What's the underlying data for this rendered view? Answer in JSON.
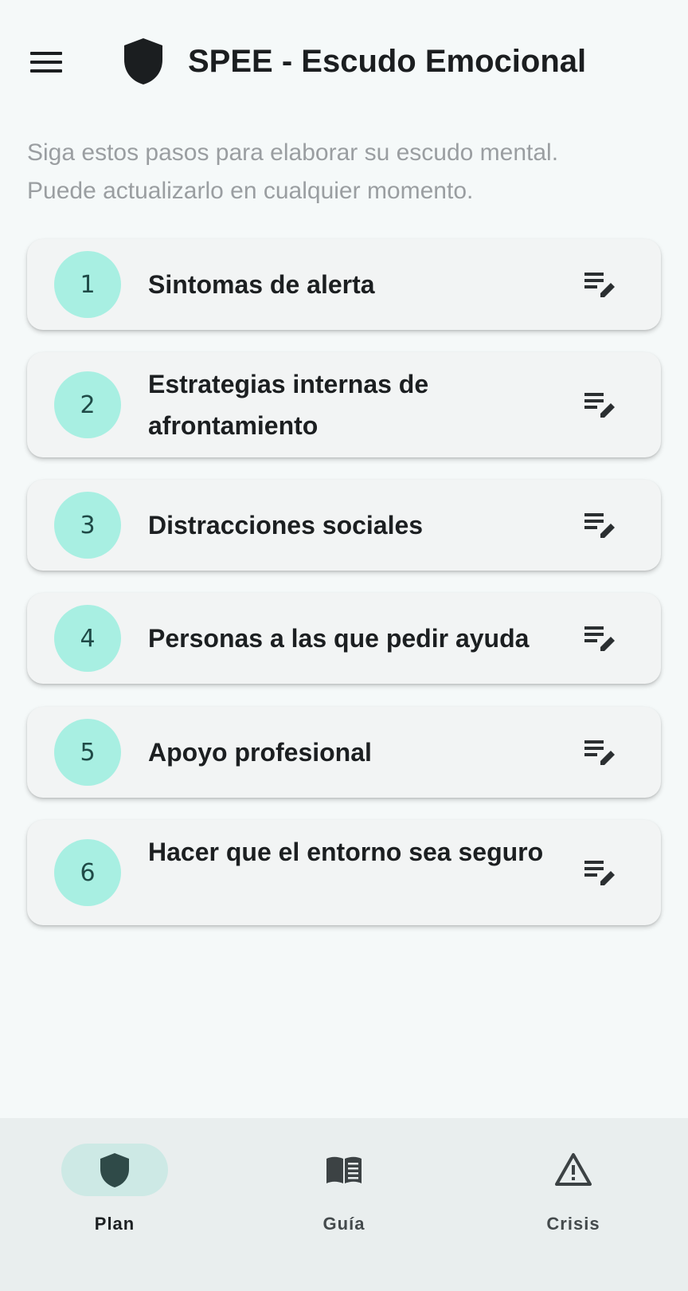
{
  "app_bar": {
    "menu_icon": "hamburger-menu-icon",
    "logo_icon": "shield-icon",
    "title": "SPEE - Escudo Emocional"
  },
  "intro": {
    "line1": "Siga estos pasos para elaborar su escudo mental.",
    "line2": "Puede actualizarlo en cualquier momento."
  },
  "steps": [
    {
      "number": "1",
      "label": "Sintomas de alerta",
      "icon": "edit-note-icon"
    },
    {
      "number": "2",
      "label": "Estrategias internas de afrontamiento",
      "icon": "edit-note-icon"
    },
    {
      "number": "3",
      "label": "Distracciones sociales",
      "icon": "edit-note-icon"
    },
    {
      "number": "4",
      "label": "Personas a las que pedir ayuda",
      "icon": "edit-note-icon"
    },
    {
      "number": "5",
      "label": "Apoyo profesional",
      "icon": "edit-note-icon"
    },
    {
      "number": "6",
      "label": "Hacer que el entorno sea seguro",
      "icon": "edit-note-icon"
    }
  ],
  "bottom_nav": {
    "items": [
      {
        "label": "Plan",
        "icon": "shield-icon",
        "active": true
      },
      {
        "label": "Guía",
        "icon": "book-icon",
        "active": false
      },
      {
        "label": "Crisis",
        "icon": "warning-icon",
        "active": false
      }
    ]
  },
  "colors": {
    "background": "#f5f9f9",
    "card": "#f2f4f4",
    "step_circle": "#a8efe2",
    "active_pill": "#cde9e5",
    "nav_bar": "#e9eeee"
  }
}
